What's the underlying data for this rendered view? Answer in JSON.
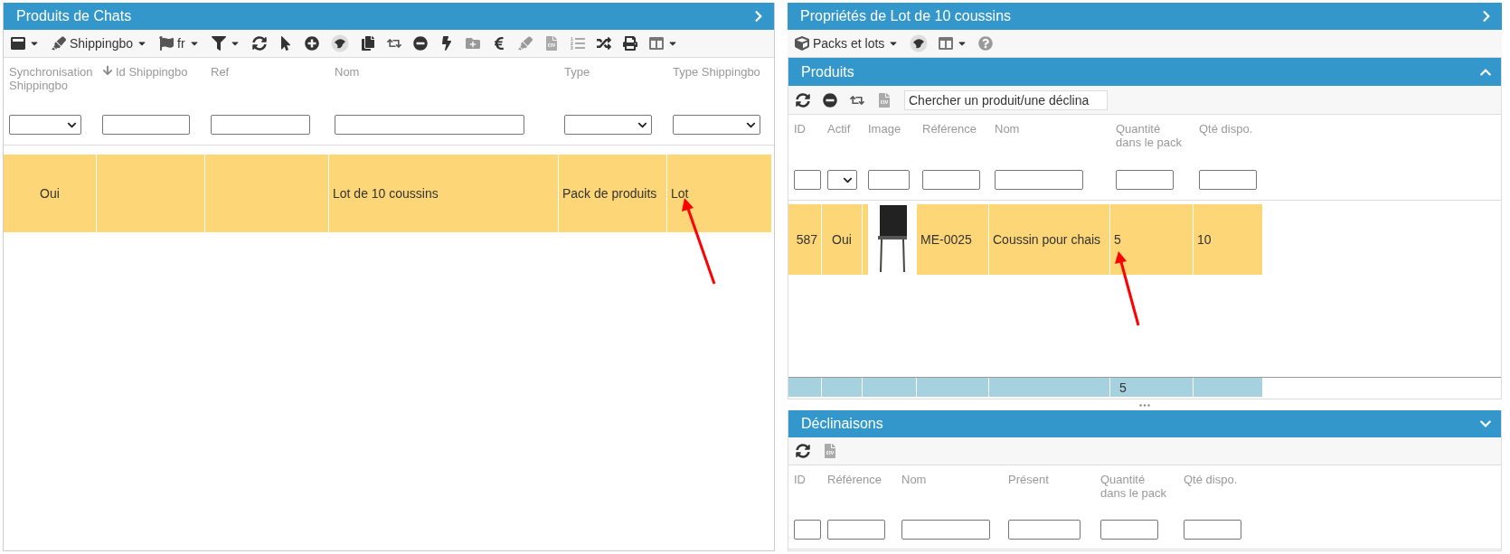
{
  "left_panel": {
    "title": "Produits de Chats",
    "toolbar_labels": [
      "Shippingbo",
      "fr"
    ],
    "columns": [
      {
        "label": "Synchronisation Shippingbo",
        "kind": "select",
        "sorted": false
      },
      {
        "label": "Id Shippingbo",
        "kind": "text",
        "sorted": true
      },
      {
        "label": "Ref",
        "kind": "text",
        "sorted": false
      },
      {
        "label": "Nom",
        "kind": "text",
        "sorted": false
      },
      {
        "label": "Type",
        "kind": "select",
        "sorted": false
      },
      {
        "label": "Type Shippingbo",
        "kind": "select",
        "sorted": false
      }
    ],
    "rows": [
      {
        "selected": true,
        "cells": [
          {
            "kind": "text",
            "text": "Oui"
          },
          {
            "kind": "empty"
          },
          {
            "kind": "empty"
          },
          {
            "kind": "text",
            "text": "Lot de 10 coussins"
          },
          {
            "kind": "text",
            "text": "Pack de produits"
          },
          {
            "kind": "text",
            "text": "Lot"
          }
        ]
      }
    ]
  },
  "right_panel": {
    "title": "Propriétés de Lot de 10 coussins",
    "toolbar_label": "Packs et lots",
    "produits": {
      "title": "Produits",
      "expanded": true,
      "search": {
        "placeholder": "Chercher un produit/une déclina"
      },
      "columns": [
        {
          "label": "ID",
          "kind": "text"
        },
        {
          "label": "Actif",
          "kind": "select"
        },
        {
          "label": "Image",
          "kind": "text"
        },
        {
          "label": "Référence",
          "kind": "text"
        },
        {
          "label": "Nom",
          "kind": "text"
        },
        {
          "label": "Quantité dans le pack",
          "kind": "text"
        },
        {
          "label": "Qté dispo.",
          "kind": "text"
        }
      ],
      "rows": [
        {
          "selected": true,
          "cells": [
            {
              "kind": "text",
              "text": "587"
            },
            {
              "kind": "text",
              "text": "Oui"
            },
            {
              "kind": "image"
            },
            {
              "kind": "text",
              "text": "ME-0025"
            },
            {
              "kind": "text",
              "text": "Coussin pour chais"
            },
            {
              "kind": "text",
              "text": "5"
            },
            {
              "kind": "text",
              "text": "10"
            }
          ]
        }
      ],
      "totals": [
        {
          "kind": "empty"
        },
        {
          "kind": "empty"
        },
        {
          "kind": "empty"
        },
        {
          "kind": "empty"
        },
        {
          "kind": "empty"
        },
        {
          "kind": "text",
          "text": "5"
        },
        {
          "kind": "empty"
        }
      ]
    },
    "declinaisons": {
      "title": "Déclinaisons",
      "expanded": false,
      "columns": [
        {
          "label": "ID",
          "kind": "text"
        },
        {
          "label": "Référence",
          "kind": "text"
        },
        {
          "label": "Nom",
          "kind": "text"
        },
        {
          "label": "Présent",
          "kind": "text"
        },
        {
          "label": "Quantité dans le pack",
          "kind": "text"
        },
        {
          "label": "Qté dispo.",
          "kind": "text"
        }
      ]
    }
  }
}
